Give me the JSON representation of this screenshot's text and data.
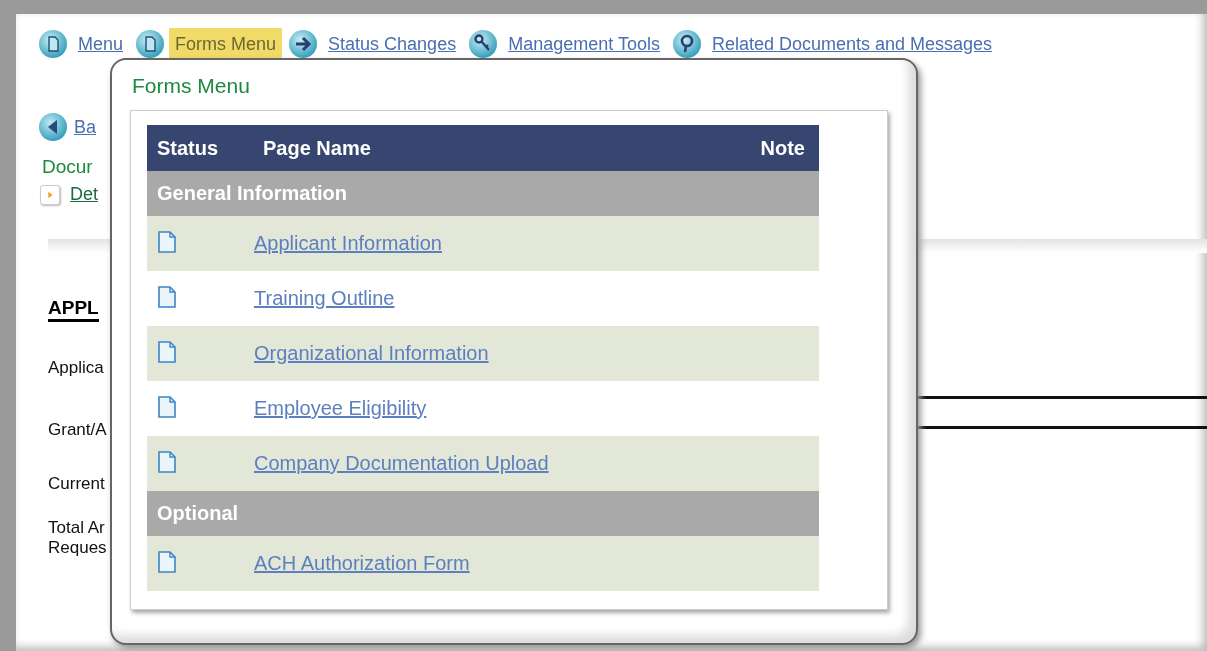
{
  "nav": [
    {
      "label": "Menu",
      "kind": "page",
      "selected": false
    },
    {
      "label": "Forms Menu",
      "kind": "page",
      "selected": true
    },
    {
      "label": "Status Changes",
      "kind": "arrow",
      "selected": false
    },
    {
      "label": "Management Tools",
      "kind": "key",
      "selected": false
    },
    {
      "label": "Related Documents and Messages",
      "kind": "pin",
      "selected": false
    }
  ],
  "back_link": "Ba",
  "section_title": "Docur",
  "details_link": "Det",
  "heading": "APPL",
  "fields": [
    {
      "label": "Applica"
    },
    {
      "label": "Grant/A"
    },
    {
      "label": "Current"
    },
    {
      "label": "Total Ar\nReques"
    }
  ],
  "popup": {
    "title": "Forms Menu",
    "columns": [
      "Status",
      "Page Name",
      "Note"
    ],
    "groups": [
      {
        "name": "General Information",
        "rows": [
          {
            "page": "Applicant Information"
          },
          {
            "page": "Training Outline"
          },
          {
            "page": "Organizational Information"
          },
          {
            "page": "Employee Eligibility"
          },
          {
            "page": "Company Documentation Upload"
          }
        ]
      },
      {
        "name": "Optional",
        "rows": [
          {
            "page": "ACH Authorization Form"
          }
        ]
      }
    ]
  }
}
